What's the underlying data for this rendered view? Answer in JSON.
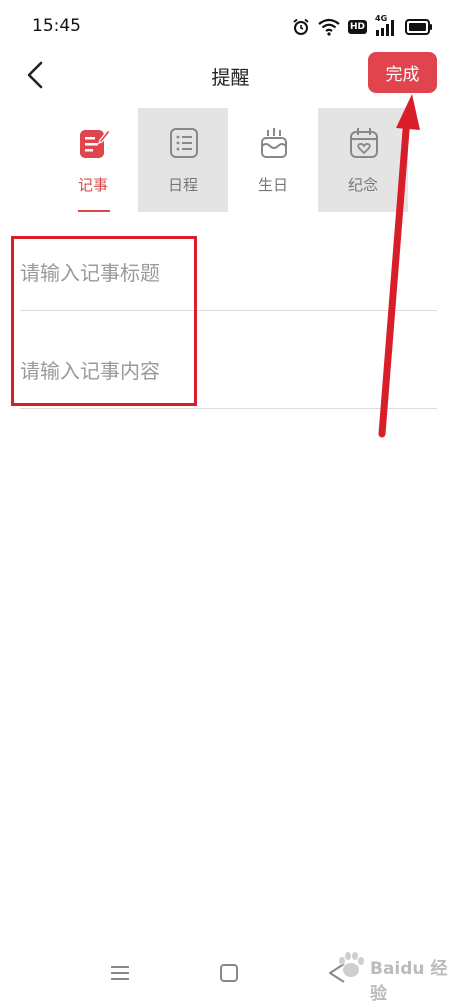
{
  "status_bar": {
    "time": "15:45",
    "icons": [
      "alarm-icon",
      "wifi-icon",
      "hd-icon",
      "signal-4g-icon",
      "battery-icon"
    ],
    "hd_label": "HD",
    "network_label": "4G"
  },
  "header": {
    "title": "提醒",
    "done_label": "完成",
    "back_icon": "chevron-left-icon"
  },
  "tabs": [
    {
      "label": "记事",
      "icon": "note-edit-icon",
      "active": true
    },
    {
      "label": "日程",
      "icon": "checklist-icon",
      "active": false
    },
    {
      "label": "生日",
      "icon": "cake-icon",
      "active": false
    },
    {
      "label": "纪念",
      "icon": "calendar-heart-icon",
      "active": false
    }
  ],
  "form": {
    "title_placeholder": "请输入记事标题",
    "title_value": "",
    "content_placeholder": "请输入记事内容",
    "content_value": ""
  },
  "nav_bar": {
    "icons": [
      "menu-icon",
      "home-square-icon",
      "back-triangle-icon"
    ]
  },
  "watermark": {
    "text": "Baidu 经验"
  },
  "colors": {
    "accent": "#e0444d",
    "active_tab": "#d64a4a",
    "annotation_red": "#d81e28",
    "tab_grey": "#e4e4e4"
  }
}
